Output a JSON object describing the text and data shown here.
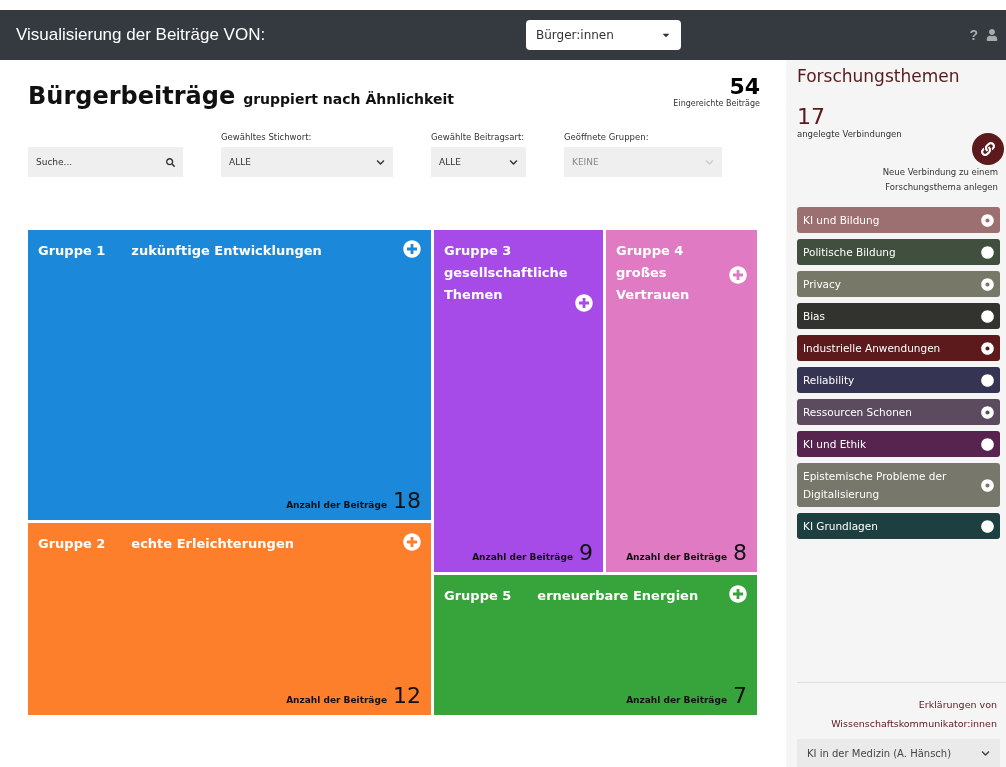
{
  "navbar": {
    "title": "Visualisierung der Beiträge VON:",
    "role_select": "Bürger:innen",
    "help": "?"
  },
  "header": {
    "title": "Bürgerbeiträge",
    "subtitle": "gruppiert nach Ähnlichkeit",
    "count": "54",
    "count_label": "Eingereichte Beiträge"
  },
  "filters": [
    {
      "kind": "search",
      "placeholder": "Suche..."
    },
    {
      "kind": "select",
      "label": "Gewähltes Stichwort:",
      "value": "ALLE",
      "disabled": false
    },
    {
      "kind": "select",
      "label": "Gewählte Beitragsart:",
      "value": "ALLE",
      "disabled": false
    },
    {
      "kind": "multiselect",
      "label": "Geöffnete Gruppen:",
      "value": "KEINE",
      "disabled": true
    }
  ],
  "groups": [
    {
      "name": "Gruppe 1",
      "topic": "zukünftige Entwicklungen",
      "count_label": "Anzahl der Beiträge",
      "count": "18",
      "color": "#1c88d9"
    },
    {
      "name": "Gruppe 2",
      "topic": "echte Erleichterungen",
      "count_label": "Anzahl der Beiträge",
      "count": "12",
      "color": "#fd7f2c"
    },
    {
      "name": "Gruppe 3",
      "topic": "gesellschaftliche Themen",
      "count_label": "Anzahl der Beiträge",
      "count": "9",
      "color": "#a64ae8"
    },
    {
      "name": "Gruppe 4",
      "topic": "großes Vertrauen",
      "count_label": "Anzahl der Beiträge",
      "count": "8",
      "color": "#e07ac2"
    },
    {
      "name": "Gruppe 5",
      "topic": "erneuerbare Energien",
      "count_label": "Anzahl der Beiträge",
      "count": "7",
      "color": "#36a33b"
    }
  ],
  "sidebar": {
    "title": "Forschungsthemen",
    "count": "17",
    "count_label": "angelegte Verbindungen",
    "new_link": "Neue Verbindung zu einem Forschungsthema anlegen",
    "topics": [
      {
        "label": "KI und Bildung",
        "color": "#9c7070"
      },
      {
        "label": "Politische Bildung",
        "color": "#404f3e"
      },
      {
        "label": "Privacy",
        "color": "#787869"
      },
      {
        "label": "Bias",
        "color": "#32332f"
      },
      {
        "label": "Industrielle Anwendungen",
        "color": "#5c1a1c"
      },
      {
        "label": "Reliability",
        "color": "#353452"
      },
      {
        "label": "Ressourcen Schonen",
        "color": "#5c4a5e"
      },
      {
        "label": "KI und Ethik",
        "color": "#56244f"
      },
      {
        "label": "Epistemische Probleme der Digitalisierung",
        "color": "#77786b"
      },
      {
        "label": "KI Grundlagen",
        "color": "#1d3f40"
      }
    ],
    "explanations_title": "Erklärungen von Wissenschaftskommunikator:innen",
    "explanation_select": "KI in der Medizin (A. Hänsch)"
  }
}
